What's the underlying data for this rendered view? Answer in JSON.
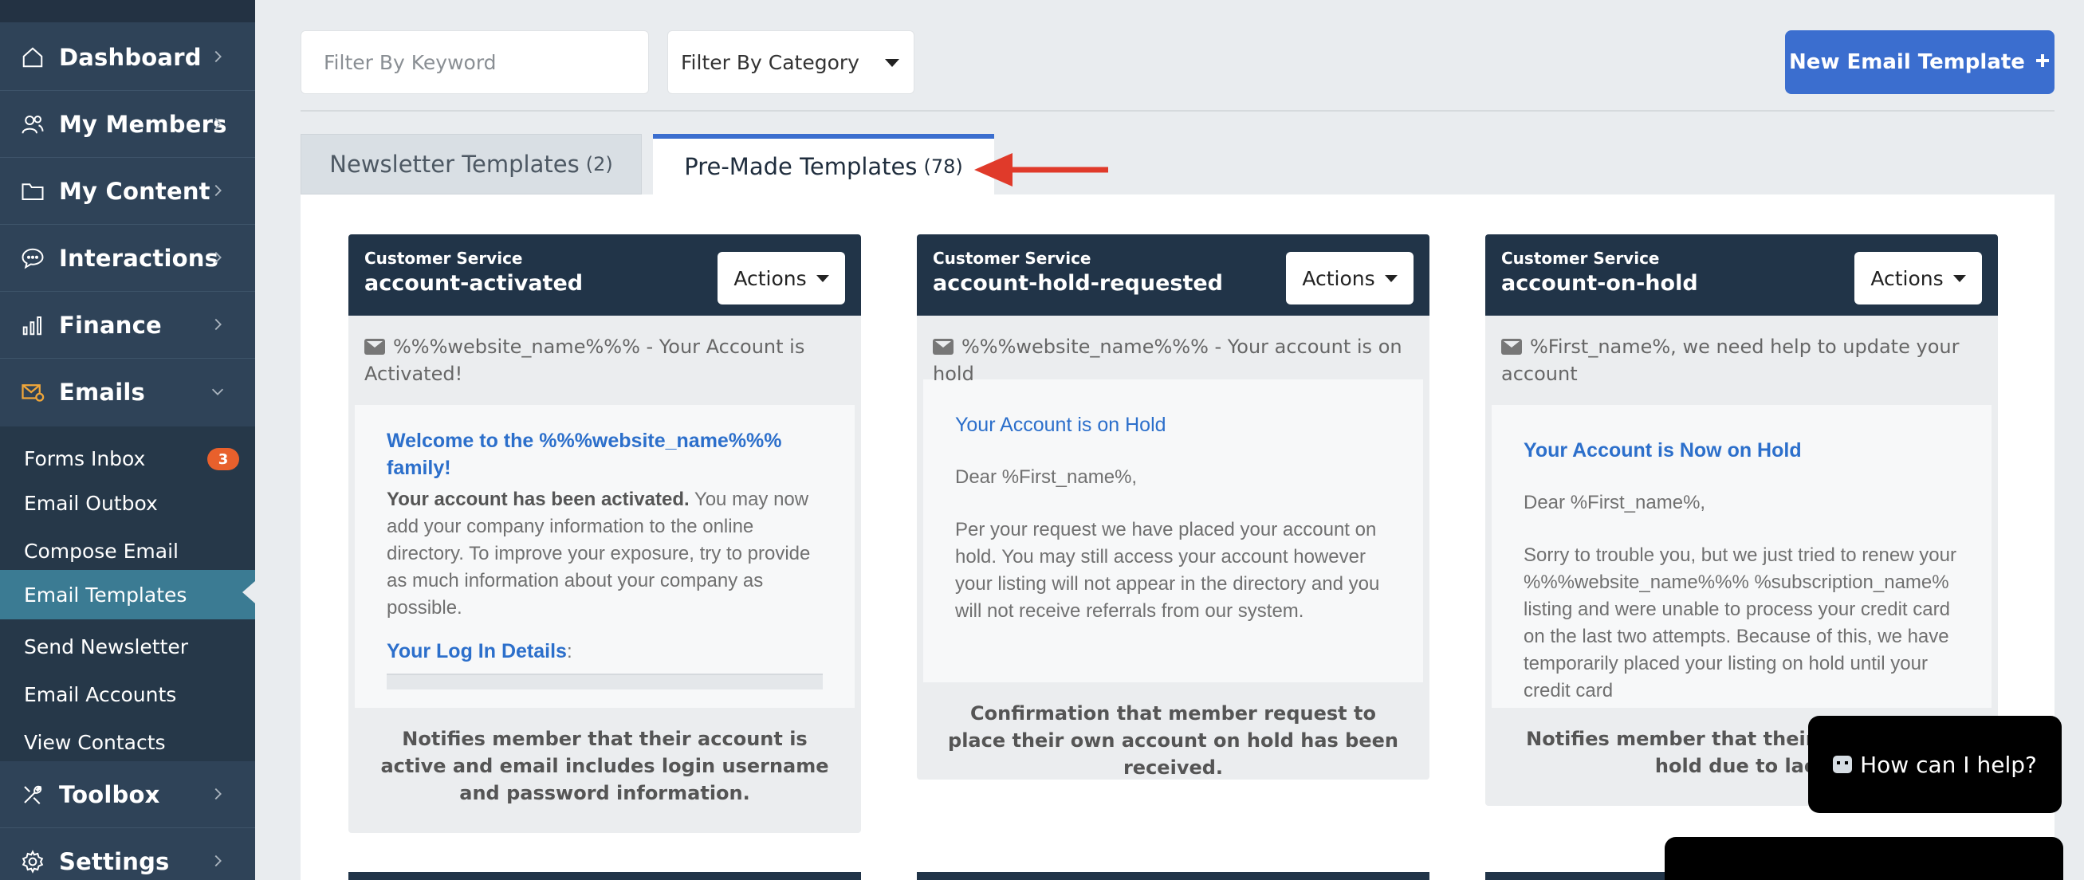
{
  "sidebar": {
    "items": [
      {
        "label": "Dashboard",
        "icon": "home-icon"
      },
      {
        "label": "My Members",
        "icon": "users-icon"
      },
      {
        "label": "My Content",
        "icon": "folder-icon"
      },
      {
        "label": "Interactions",
        "icon": "chat-icon"
      },
      {
        "label": "Finance",
        "icon": "bar-chart-icon"
      },
      {
        "label": "Emails",
        "icon": "email-settings-icon",
        "expanded": true
      },
      {
        "label": "Toolbox",
        "icon": "tools-icon"
      },
      {
        "label": "Settings",
        "icon": "gear-icon"
      }
    ],
    "email_submenu": [
      {
        "label": "Forms Inbox",
        "badge": "3"
      },
      {
        "label": "Email Outbox"
      },
      {
        "label": "Compose Email"
      },
      {
        "label": "Email Templates",
        "active": true
      },
      {
        "label": "Send Newsletter"
      },
      {
        "label": "Email Accounts"
      },
      {
        "label": "View Contacts"
      }
    ]
  },
  "toolbar": {
    "keyword_placeholder": "Filter By Keyword",
    "category_value": "Filter By Category",
    "new_button_label": "New Email Template",
    "new_button_icon": "plus-icon"
  },
  "tabs": [
    {
      "label": "Newsletter Templates",
      "count": "(2)"
    },
    {
      "label": "Pre-Made Templates",
      "count": "(78)",
      "active": true
    }
  ],
  "cards": [
    {
      "category": "Customer Service",
      "title": "account-activated",
      "actions_label": "Actions",
      "subject": "%%%website_name%%% - Your Account is Activated!",
      "body_heading": "Welcome to the %%%website_name%%% family!",
      "body_bold": "Your account has been activated.",
      "body_text": " You may now add your company information to the online directory. To improve your exposure, try to provide as much information about your company as possible.",
      "body_heading2": "Your Log In Details",
      "body_heading2_suffix": ":",
      "footer": "Notifies member that their account is active and email includes login username and password information."
    },
    {
      "category": "Customer Service",
      "title": "account-hold-requested",
      "actions_label": "Actions",
      "subject": "%%%website_name%%% - Your account is on hold",
      "body_heading": "Your Account is on Hold",
      "body_greeting": "Dear %First_name%,",
      "body_text": "Per your request we have placed your account on hold. You may still access your account however your listing will not appear in the directory and you will not receive referrals from our system.",
      "footer": "Confirmation that member request to place their own account on hold has been received."
    },
    {
      "category": "Customer Service",
      "title": "account-on-hold",
      "actions_label": "Actions",
      "subject": "%First_name%, we need help to update your account",
      "body_heading": "Your Account is Now on Hold",
      "body_greeting": "Dear %First_name%,",
      "body_text": "Sorry to trouble you, but we just tried to renew your %%%website_name%%% %subscription_name% listing and were unable to process your credit card on the last two attempts.  Because of this, we have temporarily placed your listing on hold until your credit card",
      "footer": "Notifies member that their ac placed on hold due to lack"
    }
  ],
  "chat": {
    "help_label": "How can I help?"
  },
  "colors": {
    "sidebar_bg": "#2f4358",
    "card_header_bg": "#213448",
    "accent_blue": "#3b6ecf",
    "active_nav": "#3b7b93",
    "badge": "#e8602c",
    "annotation_arrow": "#e03a2a"
  }
}
